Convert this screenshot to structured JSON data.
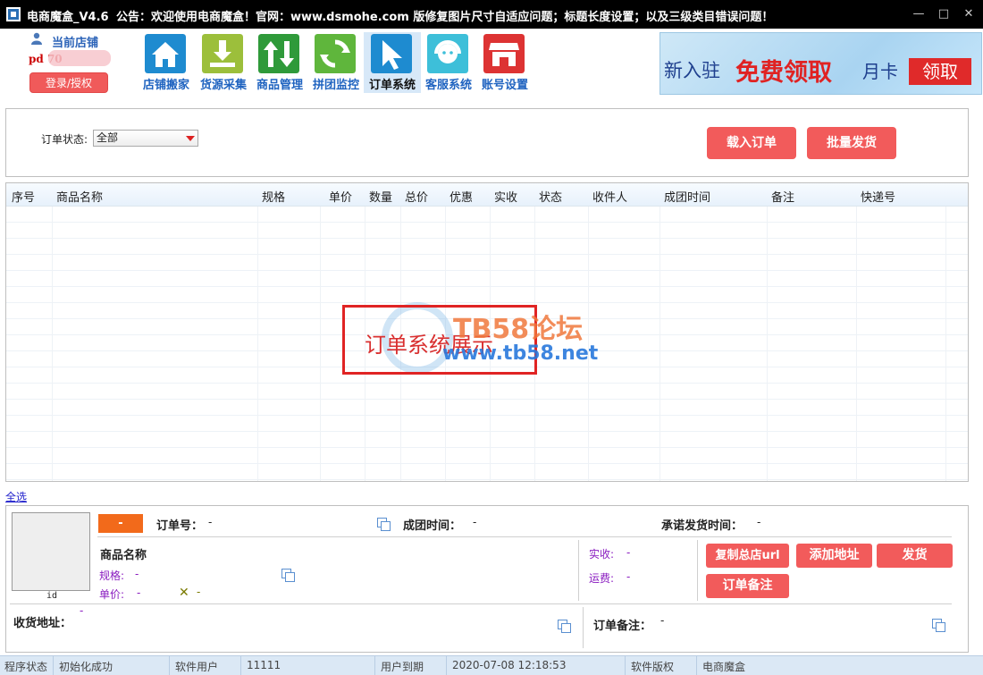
{
  "titlebar": {
    "app_name": "电商魔盒_V4.6",
    "notice": "公告：欢迎使用电商魔盒！官网：www.dsmohe.com  版修复图片尺寸自适应问题；标题长度设置；以及三级类目错误问题！",
    "minimize": "—",
    "maximize": "□",
    "close": "✕"
  },
  "shop": {
    "label": "当前店铺",
    "name": "pd          70",
    "login_button": "登录/授权"
  },
  "toolbar": [
    {
      "label": "店铺搬家",
      "icon": "home-icon",
      "color": "#1e8bd0"
    },
    {
      "label": "货源采集",
      "icon": "download-icon",
      "color": "#9cbf3b"
    },
    {
      "label": "商品管理",
      "icon": "updown-arrows-icon",
      "color": "#2f9a3a"
    },
    {
      "label": "拼团监控",
      "icon": "refresh-icon",
      "color": "#5fb63c"
    },
    {
      "label": "订单系统",
      "icon": "cursor-icon",
      "color": "#1e8bd0"
    },
    {
      "label": "客服系统",
      "icon": "headset-icon",
      "color": "#3dbfd9"
    },
    {
      "label": "账号设置",
      "icon": "store-icon",
      "color": "#d33"
    }
  ],
  "banner": {
    "part1": "新入驻",
    "part2": "免费领取",
    "part3": "月卡",
    "button": "领取"
  },
  "filter": {
    "status_label": "订单状态:",
    "status_value": "全部",
    "load_button": "载入订单",
    "batch_ship_button": "批量发货"
  },
  "grid": {
    "columns": [
      "序号",
      "商品名称",
      "规格",
      "单价",
      "数量",
      "总价",
      "优惠",
      "实收",
      "状态",
      "收件人",
      "成团时间",
      "备注",
      "快递号"
    ],
    "rows": []
  },
  "watermark": {
    "caption": "订单系统展示",
    "brand": "TB58论坛",
    "url": "www.tb58.net"
  },
  "select_all": "全选",
  "detail": {
    "badge": "-",
    "thumb_id": "id",
    "order_no_label": "订单号：",
    "order_no_value": "-",
    "group_time_label": "成团时间：",
    "group_time_value": "-",
    "promise_label": "承诺发货时间：",
    "promise_value": "-",
    "product_name_label": "商品名称",
    "spec_label": "规格:",
    "spec_value": "-",
    "price_label": "单价:",
    "price_value": "-",
    "qty_mark": "✕",
    "qty_value": "-",
    "paid_label": "实收:",
    "paid_value": "-",
    "freight_label": "运费:",
    "freight_value": "-",
    "address_label": "收货地址：",
    "address_value": "-",
    "remark_label": "订单备注：",
    "remark_value": "-",
    "btn_copy_url": "复制总店url",
    "btn_add_address": "添加地址",
    "btn_ship": "发货",
    "btn_remark": "订单备注"
  },
  "statusbar": {
    "status_label": "程序状态",
    "status_value": "初始化成功",
    "user_label": "软件用户",
    "user_value": "11111",
    "expire_label": "用户到期",
    "expire_value": "2020-07-08 12:18:53",
    "copyright_label": "软件版权",
    "copyright_value": "电商魔盒"
  }
}
